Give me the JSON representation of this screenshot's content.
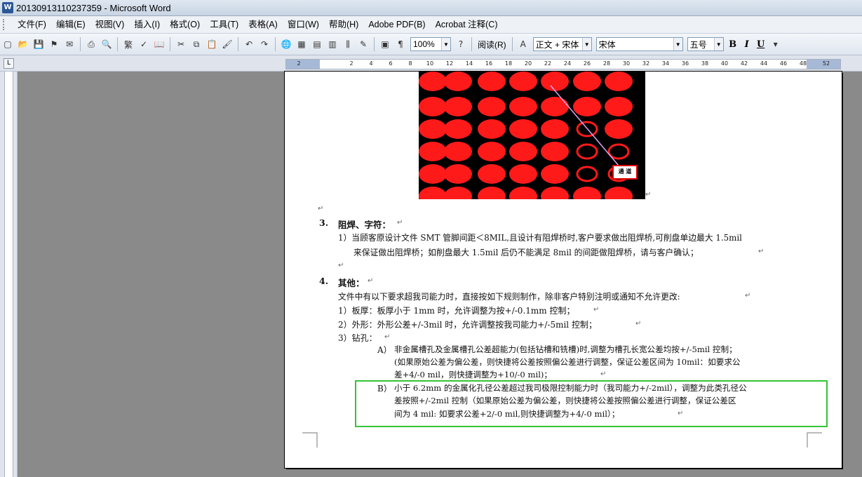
{
  "window": {
    "title": "20130913110237359 - Microsoft Word",
    "app_icon": "W"
  },
  "menu": [
    "文件(F)",
    "编辑(E)",
    "视图(V)",
    "插入(I)",
    "格式(O)",
    "工具(T)",
    "表格(A)",
    "窗口(W)",
    "帮助(H)",
    "Adobe PDF(B)",
    "Acrobat 注释(C)"
  ],
  "toolbar": {
    "zoom": "100%",
    "read_label": "阅读(R)",
    "style": "正文 + 宋体",
    "font": "宋体",
    "size": "五号",
    "bold": "B",
    "italic": "I",
    "underline": "U"
  },
  "ruler": {
    "ticks": [
      "2",
      "2",
      "4",
      "6",
      "8",
      "10",
      "12",
      "14",
      "16",
      "18",
      "20",
      "22",
      "24",
      "26",
      "28",
      "30",
      "32",
      "34",
      "36",
      "38",
      "40",
      "42",
      "44",
      "46",
      "48",
      "52"
    ]
  },
  "document": {
    "image_callout": "通 道",
    "sec3_num": "3.",
    "sec3_title": "阻焊、字符：",
    "sec3_l1": "1）当顾客原设计文件 SMT 管脚间距＜8MIL,且设计有阻焊桥时,客户要求做出阻焊桥,可削盘单边最大 1.5mil",
    "sec3_l2": "来保证做出阻焊桥；如削盘最大 1.5mil 后仍不能满足 8mil 的间距做阻焊桥，请与客户确认；",
    "sec4_num": "4.",
    "sec4_title": "其他：",
    "sec4_intro": "文件中有以下要求超我司能力时，直接按如下规则制作，除非客户特别注明或通知不允许更改:",
    "sec4_l1": "1）板厚：板厚小于 1mm 时，允许调整为按+/-0.1mm 控制；",
    "sec4_l2": "2）外形：外形公差+/-3mil 时，允许调整按我司能力+/-5mil 控制；",
    "sec4_l3": "3）钻孔：",
    "a_label": "A）",
    "a_l1": "非金属槽孔及金属槽孔公差超能力(包括钻槽和铣槽)时,调整为槽孔长宽公差均按+/-5mil 控制；",
    "a_l2": "(如果原始公差为偏公差，则快捷将公差按照偏公差进行调整，保证公差区间为 10mil：如要求公",
    "a_l3": "差+4/-0 mil，则快捷调整为+10/-0 mil)；",
    "b_label": "B）",
    "b_l1": "小于 6.2mm 的金属化孔径公差超过我司极限控制能力时（我司能力+/-2mil），调整为此类孔径公",
    "b_l2": "差按照+/-2mil 控制（如果原始公差为偏公差，则快捷将公差按照偏公差进行调整，保证公差区",
    "b_l3": "间为 4 mil:  如要求公差+2/-0 mil,则快捷调整为+4/-0 mil）；",
    "para_mark": "↵"
  },
  "colors": {
    "highlight_box": "#35c435",
    "pad_red": "#ff1a1a"
  }
}
